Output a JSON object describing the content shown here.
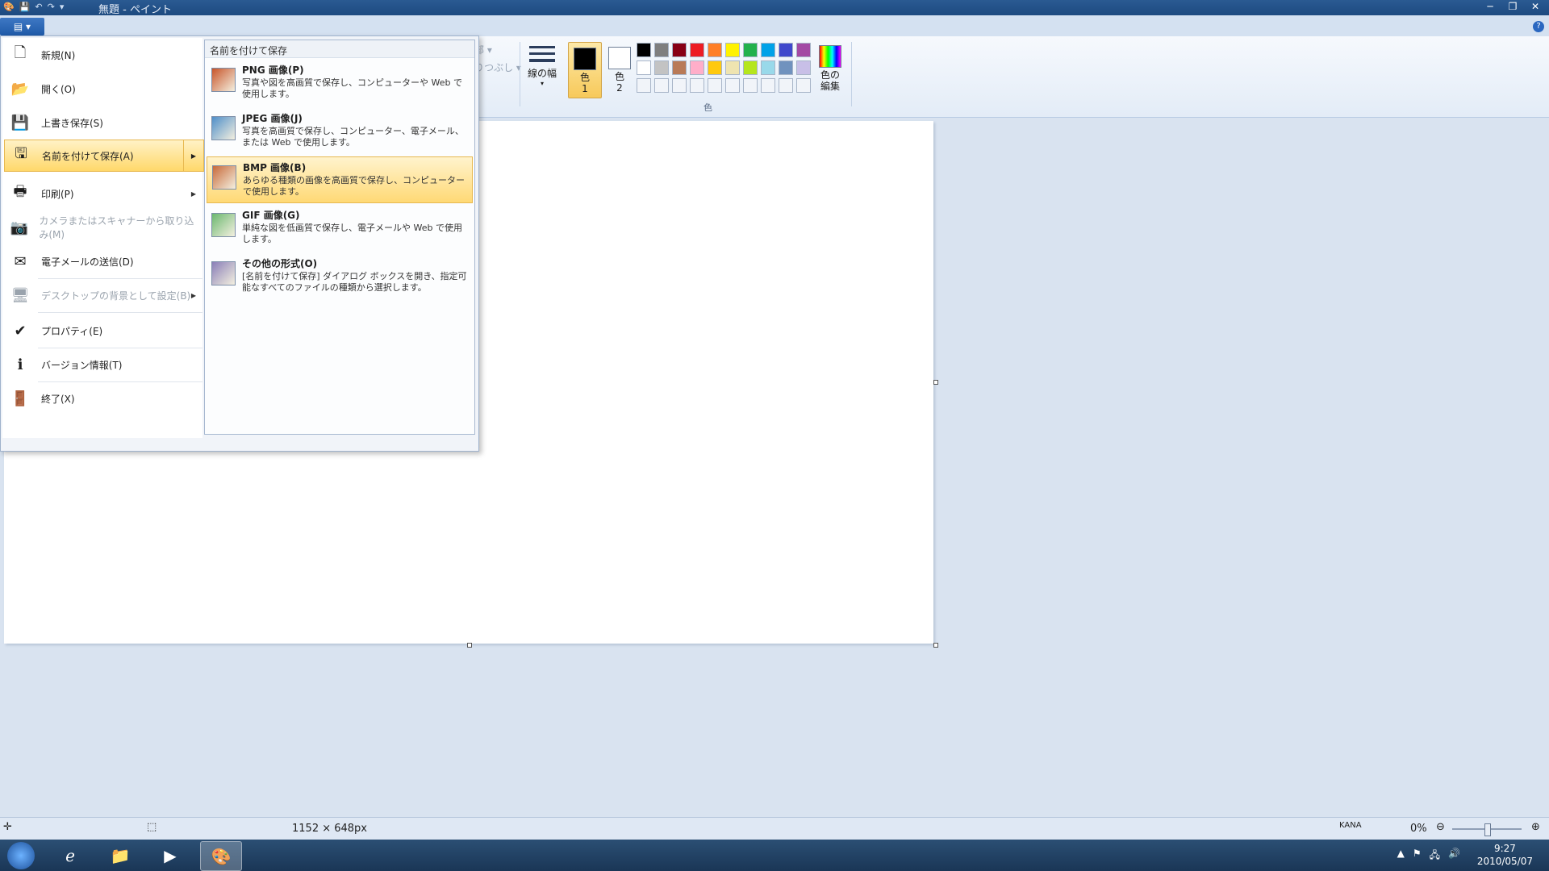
{
  "window": {
    "title": "無題 - ペイント"
  },
  "colors": {
    "accent": "#ffd86a",
    "titlebar": "#1d4a80"
  },
  "ribbon": {
    "grayed_a": "部 ▾",
    "grayed_b": "りつぶし ▾",
    "line_width_label": "線の幅",
    "color1_label": "色\n1",
    "color2_label": "色\n2",
    "edit_colors_label": "色の\n編集",
    "group_label": "色",
    "palette": [
      "#000000",
      "#7f7f7f",
      "#880015",
      "#ed1c24",
      "#ff7f27",
      "#fff200",
      "#22b14c",
      "#00a2e8",
      "#3f48cc",
      "#a349a4",
      "#ffffff",
      "#c3c3c3",
      "#b97a57",
      "#ffaec9",
      "#ffc90e",
      "#efe4b0",
      "#b5e61d",
      "#99d9ea",
      "#7092be",
      "#c8bfe7",
      "",
      "",
      "",
      "",
      "",
      "",
      "",
      "",
      "",
      ""
    ]
  },
  "app_menu": {
    "items": [
      {
        "label": "新規(N)",
        "icon": "new-file-icon",
        "glyph": "🗋",
        "state": "normal"
      },
      {
        "label": "開く(O)",
        "icon": "open-folder-icon",
        "glyph": "📂",
        "state": "normal"
      },
      {
        "label": "上書き保存(S)",
        "icon": "save-icon",
        "glyph": "💾",
        "state": "normal"
      },
      {
        "label": "名前を付けて保存(A)",
        "icon": "save-as-icon",
        "glyph": "🖫",
        "state": "selected"
      },
      {
        "label": "印刷(P)",
        "icon": "print-icon",
        "glyph": "🖶",
        "state": "normal"
      },
      {
        "label": "カメラまたはスキャナーから取り込み(M)",
        "icon": "scanner-icon",
        "glyph": "📷",
        "state": "disabled"
      },
      {
        "label": "電子メールの送信(D)",
        "icon": "email-icon",
        "glyph": "✉",
        "state": "normal"
      },
      {
        "label": "デスクトップの背景として設定(B)",
        "icon": "desktop-icon",
        "glyph": "🖥",
        "state": "disabled"
      },
      {
        "label": "プロパティ(E)",
        "icon": "properties-check-icon",
        "glyph": "✔",
        "state": "normal"
      },
      {
        "label": "バージョン情報(T)",
        "icon": "info-icon",
        "glyph": "ℹ",
        "state": "normal"
      },
      {
        "label": "終了(X)",
        "icon": "exit-icon",
        "glyph": "🚪",
        "state": "normal"
      }
    ],
    "submenu": {
      "header": "名前を付けて保存",
      "items": [
        {
          "title": "PNG 画像(P)",
          "desc": "写真や図を高画質で保存し、コンピューターや Web で使用します。",
          "icon": "png-image-icon",
          "color": "#c8552a"
        },
        {
          "title": "JPEG 画像(J)",
          "desc": "写真を高画質で保存し、コンピューター、電子メール、または Web で使用します。",
          "icon": "jpeg-image-icon",
          "color": "#4f8fc9"
        },
        {
          "title": "BMP 画像(B)",
          "desc": "あらゆる種類の画像を高画質で保存し、コンピューターで使用します。",
          "icon": "bmp-image-icon",
          "color": "#c86a3a"
        },
        {
          "title": "GIF 画像(G)",
          "desc": "単純な図を低画質で保存し、電子メールや Web で使用します。",
          "icon": "gif-image-icon",
          "color": "#6bb86f"
        },
        {
          "title": "その他の形式(O)",
          "desc": "[名前を付けて保存] ダイアログ ボックスを開き、指定可能なすべてのファイルの種類から選択します。",
          "icon": "other-formats-icon",
          "color": "#8a7fb8"
        }
      ]
    }
  },
  "status": {
    "dimensions": "1152 × 648px",
    "zoom": "0%"
  },
  "taskbar": {
    "time": "9:27",
    "date": "2010/05/07",
    "ime": "KANA"
  }
}
